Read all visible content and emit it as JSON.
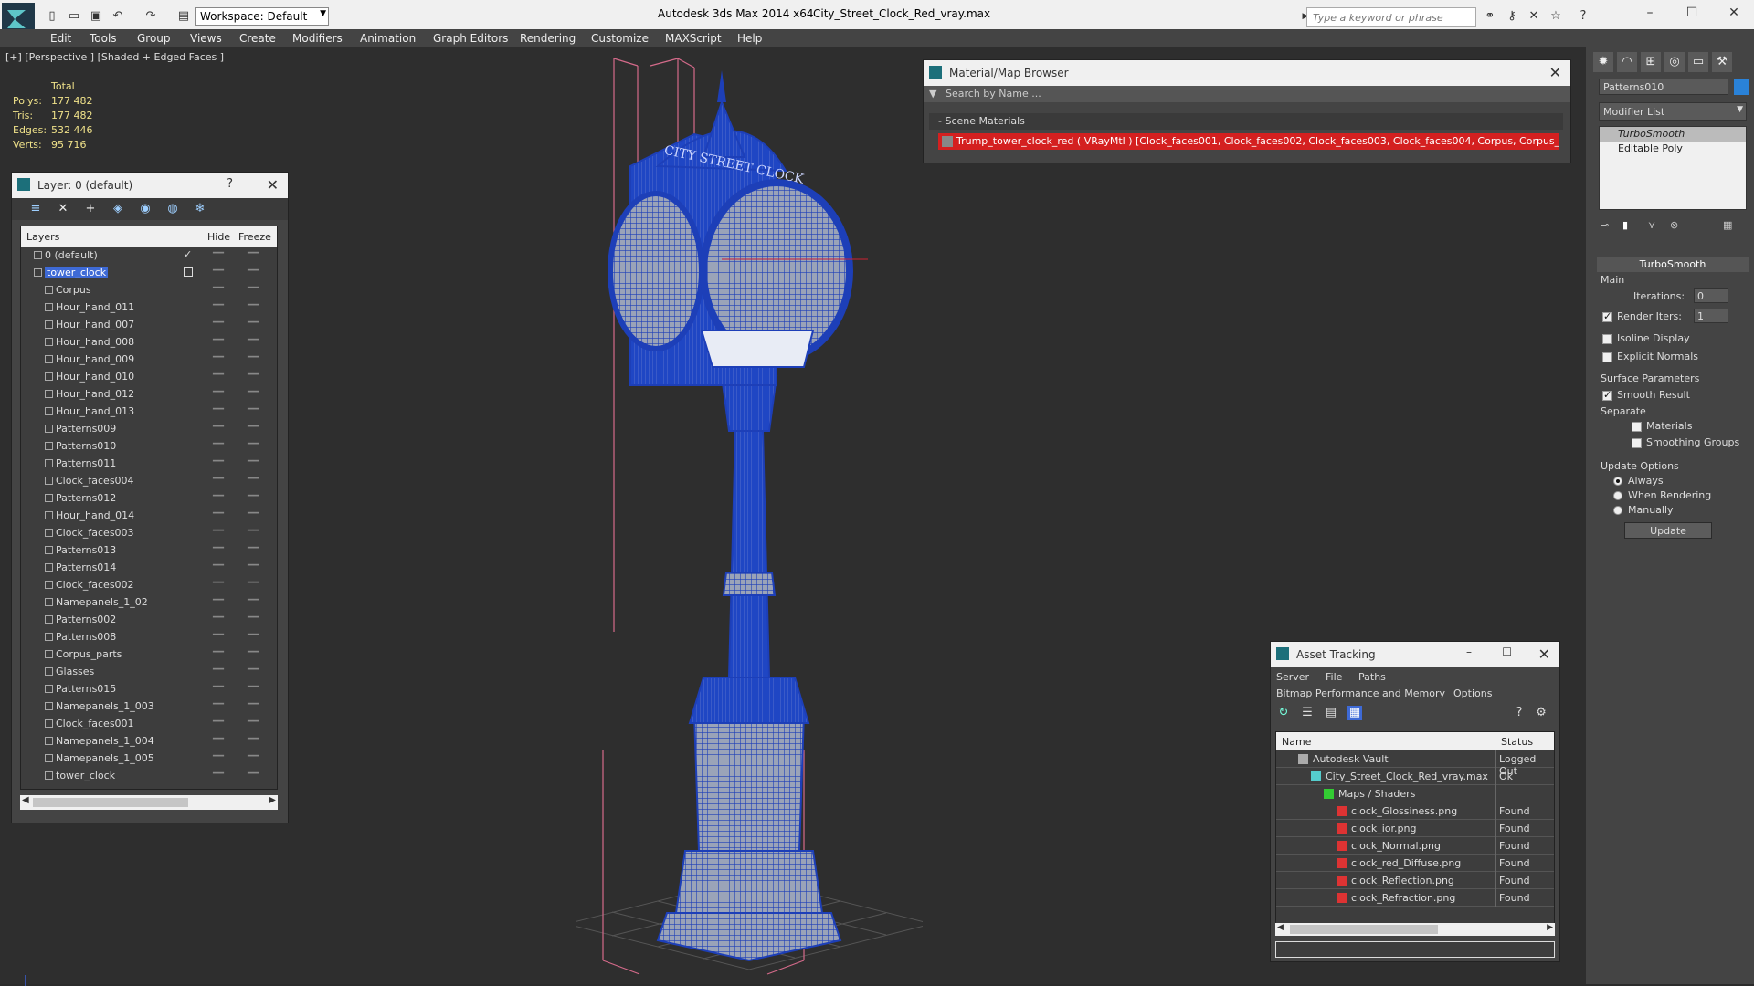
{
  "titlebar": {
    "workspace": "Workspace: Default",
    "app_title": "Autodesk 3ds Max  2014 x64",
    "file_title": "City_Street_Clock_Red_vray.max",
    "search_placeholder": "Type a keyword or phrase"
  },
  "menu": [
    "Edit",
    "Tools",
    "Group",
    "Views",
    "Create",
    "Modifiers",
    "Animation",
    "Graph Editors",
    "Rendering",
    "Customize",
    "MAXScript",
    "Help"
  ],
  "viewport": {
    "label": "[+] [Perspective ] [Shaded + Edged Faces ]",
    "stats_header": "Total",
    "stats": [
      {
        "label": "Polys:",
        "value": "177 482"
      },
      {
        "label": "Tris:",
        "value": "177 482"
      },
      {
        "label": "Edges:",
        "value": "532 446"
      },
      {
        "label": "Verts:",
        "value": "95 716"
      }
    ]
  },
  "layer_panel": {
    "title": "Layer: 0 (default)",
    "help": "?",
    "col_layers": "Layers",
    "col_hide": "Hide",
    "col_freeze": "Freeze",
    "rows": [
      {
        "name": "0 (default)",
        "level": 0,
        "type": "layer"
      },
      {
        "name": "tower_clock",
        "level": 0,
        "type": "layer",
        "selected": true
      },
      {
        "name": "Corpus",
        "level": 1,
        "type": "object"
      },
      {
        "name": "Hour_hand_011",
        "level": 1,
        "type": "object"
      },
      {
        "name": "Hour_hand_007",
        "level": 1,
        "type": "object"
      },
      {
        "name": "Hour_hand_008",
        "level": 1,
        "type": "object"
      },
      {
        "name": "Hour_hand_009",
        "level": 1,
        "type": "object"
      },
      {
        "name": "Hour_hand_010",
        "level": 1,
        "type": "object"
      },
      {
        "name": "Hour_hand_012",
        "level": 1,
        "type": "object"
      },
      {
        "name": "Hour_hand_013",
        "level": 1,
        "type": "object"
      },
      {
        "name": "Patterns009",
        "level": 1,
        "type": "object"
      },
      {
        "name": "Patterns010",
        "level": 1,
        "type": "object"
      },
      {
        "name": "Patterns011",
        "level": 1,
        "type": "object"
      },
      {
        "name": "Clock_faces004",
        "level": 1,
        "type": "object"
      },
      {
        "name": "Patterns012",
        "level": 1,
        "type": "object"
      },
      {
        "name": "Hour_hand_014",
        "level": 1,
        "type": "object"
      },
      {
        "name": "Clock_faces003",
        "level": 1,
        "type": "object"
      },
      {
        "name": "Patterns013",
        "level": 1,
        "type": "object"
      },
      {
        "name": "Patterns014",
        "level": 1,
        "type": "object"
      },
      {
        "name": "Clock_faces002",
        "level": 1,
        "type": "object"
      },
      {
        "name": "Namepanels_1_02",
        "level": 1,
        "type": "object"
      },
      {
        "name": "Patterns002",
        "level": 1,
        "type": "object"
      },
      {
        "name": "Patterns008",
        "level": 1,
        "type": "object"
      },
      {
        "name": "Corpus_parts",
        "level": 1,
        "type": "object"
      },
      {
        "name": "Glasses",
        "level": 1,
        "type": "object"
      },
      {
        "name": "Patterns015",
        "level": 1,
        "type": "object"
      },
      {
        "name": "Namepanels_1_003",
        "level": 1,
        "type": "object"
      },
      {
        "name": "Clock_faces001",
        "level": 1,
        "type": "object"
      },
      {
        "name": "Namepanels_1_004",
        "level": 1,
        "type": "object"
      },
      {
        "name": "Namepanels_1_005",
        "level": 1,
        "type": "object"
      },
      {
        "name": "tower_clock",
        "level": 1,
        "type": "object"
      }
    ]
  },
  "material_browser": {
    "title": "Material/Map Browser",
    "search_placeholder": "Search by Name ...",
    "section": "- Scene Materials",
    "entry": "Trump_tower_clock_red  ( VRayMtl ) [Clock_faces001, Clock_faces002, Clock_faces003, Clock_faces004, Corpus, Corpus_parts..."
  },
  "command_panel": {
    "object_name": "Patterns010",
    "object_color": "#2a82d8",
    "modifier_list": "Modifier List",
    "stack": [
      "TurboSmooth",
      "Editable Poly"
    ],
    "rollout_title": "TurboSmooth",
    "main_label": "Main",
    "iterations_label": "Iterations:",
    "iterations_value": "0",
    "render_iters_label": "Render Iters:",
    "render_iters_value": "1",
    "render_iters_checked": true,
    "isoline_label": "Isoline Display",
    "explicit_label": "Explicit Normals",
    "surface_label": "Surface Parameters",
    "smooth_label": "Smooth Result",
    "separate_label": "Separate",
    "materials_label": "Materials",
    "smoothing_label": "Smoothing Groups",
    "update_options_label": "Update Options",
    "always_label": "Always",
    "when_rendering_label": "When Rendering",
    "manually_label": "Manually",
    "update_button": "Update"
  },
  "asset_tracking": {
    "title": "Asset Tracking",
    "menu": [
      "Server",
      "File",
      "Paths"
    ],
    "menu2": [
      "Bitmap Performance and Memory",
      "Options"
    ],
    "col_name": "Name",
    "col_status": "Status",
    "rows": [
      {
        "name": "Autodesk Vault",
        "status": "Logged Out",
        "indent": 1
      },
      {
        "name": "City_Street_Clock_Red_vray.max",
        "status": "Ok",
        "indent": 2
      },
      {
        "name": "Maps / Shaders",
        "status": "",
        "indent": 3
      },
      {
        "name": "clock_Glossiness.png",
        "status": "Found",
        "indent": 4
      },
      {
        "name": "clock_ior.png",
        "status": "Found",
        "indent": 4
      },
      {
        "name": "clock_Normal.png",
        "status": "Found",
        "indent": 4
      },
      {
        "name": "clock_red_Diffuse.png",
        "status": "Found",
        "indent": 4
      },
      {
        "name": "clock_Reflection.png",
        "status": "Found",
        "indent": 4
      },
      {
        "name": "clock_Refraction.png",
        "status": "Found",
        "indent": 4
      }
    ]
  },
  "clock_sign_text": "CITY STREET CLOCK"
}
